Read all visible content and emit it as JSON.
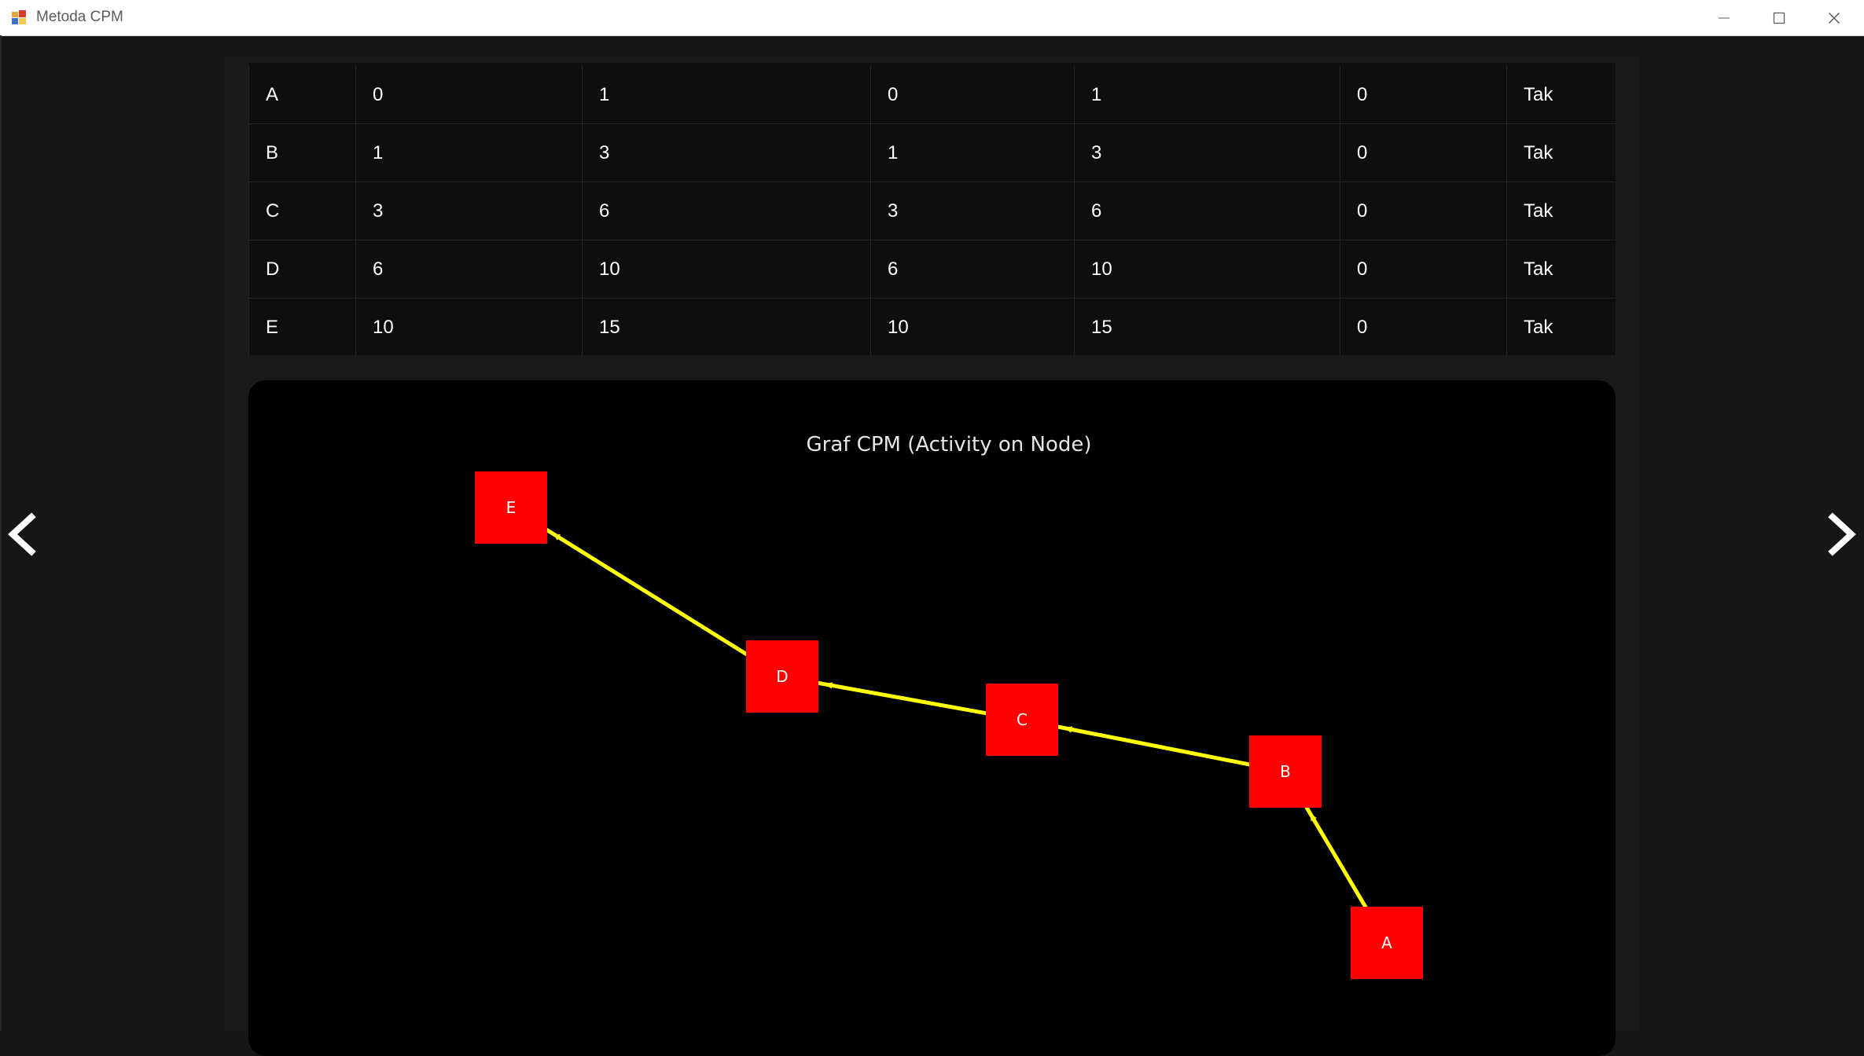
{
  "window": {
    "title": "Metoda CPM"
  },
  "table": {
    "rows": [
      {
        "cells": [
          "A",
          "0",
          "1",
          "0",
          "1",
          "0",
          "Tak"
        ]
      },
      {
        "cells": [
          "B",
          "1",
          "3",
          "1",
          "3",
          "0",
          "Tak"
        ]
      },
      {
        "cells": [
          "C",
          "3",
          "6",
          "3",
          "6",
          "0",
          "Tak"
        ]
      },
      {
        "cells": [
          "D",
          "6",
          "10",
          "6",
          "10",
          "0",
          "Tak"
        ]
      },
      {
        "cells": [
          "E",
          "10",
          "15",
          "10",
          "15",
          "0",
          "Tak"
        ]
      }
    ]
  },
  "graph": {
    "title": "Graf CPM (Activity on Node)",
    "node_color": "#ff0000",
    "edge_color": "#ffff00",
    "nodes": [
      "A",
      "B",
      "C",
      "D",
      "E"
    ],
    "edges": [
      {
        "from": "A",
        "to": "B"
      },
      {
        "from": "B",
        "to": "C"
      },
      {
        "from": "C",
        "to": "D"
      },
      {
        "from": "D",
        "to": "E"
      }
    ]
  },
  "icons": {
    "prev": "chevron-left-icon",
    "next": "chevron-right-icon",
    "minimize": "minimize-icon",
    "maximize": "maximize-icon",
    "close": "close-icon"
  }
}
